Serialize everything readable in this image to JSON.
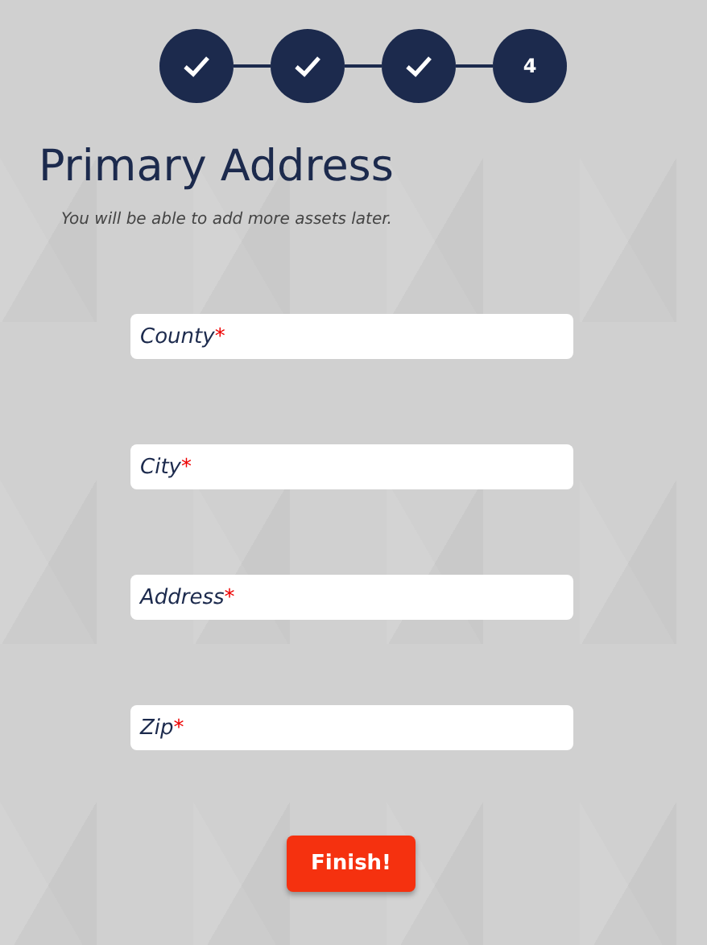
{
  "steps": [
    {
      "done": true
    },
    {
      "done": true
    },
    {
      "done": true
    },
    {
      "done": false,
      "label": "4"
    }
  ],
  "title": "Primary Address",
  "subtitle": "You will be able to add more assets later.",
  "fields": [
    {
      "placeholder": "County",
      "required_mark": "*"
    },
    {
      "placeholder": "City",
      "required_mark": "*"
    },
    {
      "placeholder": "Address",
      "required_mark": "*"
    },
    {
      "placeholder": "Zip",
      "required_mark": "*"
    }
  ],
  "button": "Finish!"
}
